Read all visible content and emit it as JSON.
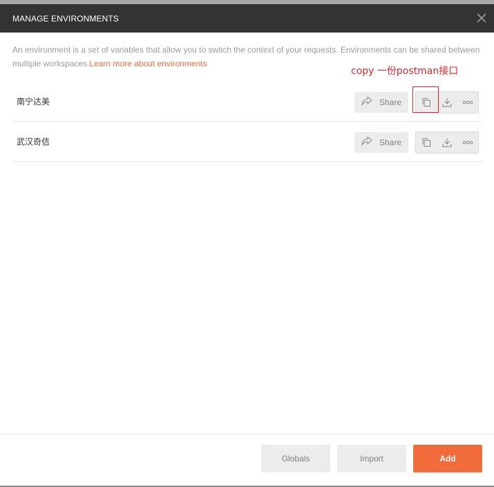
{
  "modal": {
    "title": "MANAGE ENVIRONMENTS",
    "description": "An environment is a set of variables that allow you to switch the context of your requests. Environments can be shared between multiple workspaces.",
    "learn_more_link": "Learn more about environments"
  },
  "annotation": "copy  一份postman接口",
  "environments": [
    {
      "name": "南宁达美",
      "share_label": "Share"
    },
    {
      "name": "武汉奇佶",
      "share_label": "Share"
    }
  ],
  "footer": {
    "globals_label": "Globals",
    "import_label": "Import",
    "add_label": "Add"
  },
  "colors": {
    "header_bg": "#333333",
    "accent": "#f26b3a",
    "annotation_red": "#e3242b"
  },
  "icons": [
    "close-icon",
    "share-icon",
    "duplicate-icon",
    "download-icon",
    "more-icon"
  ]
}
